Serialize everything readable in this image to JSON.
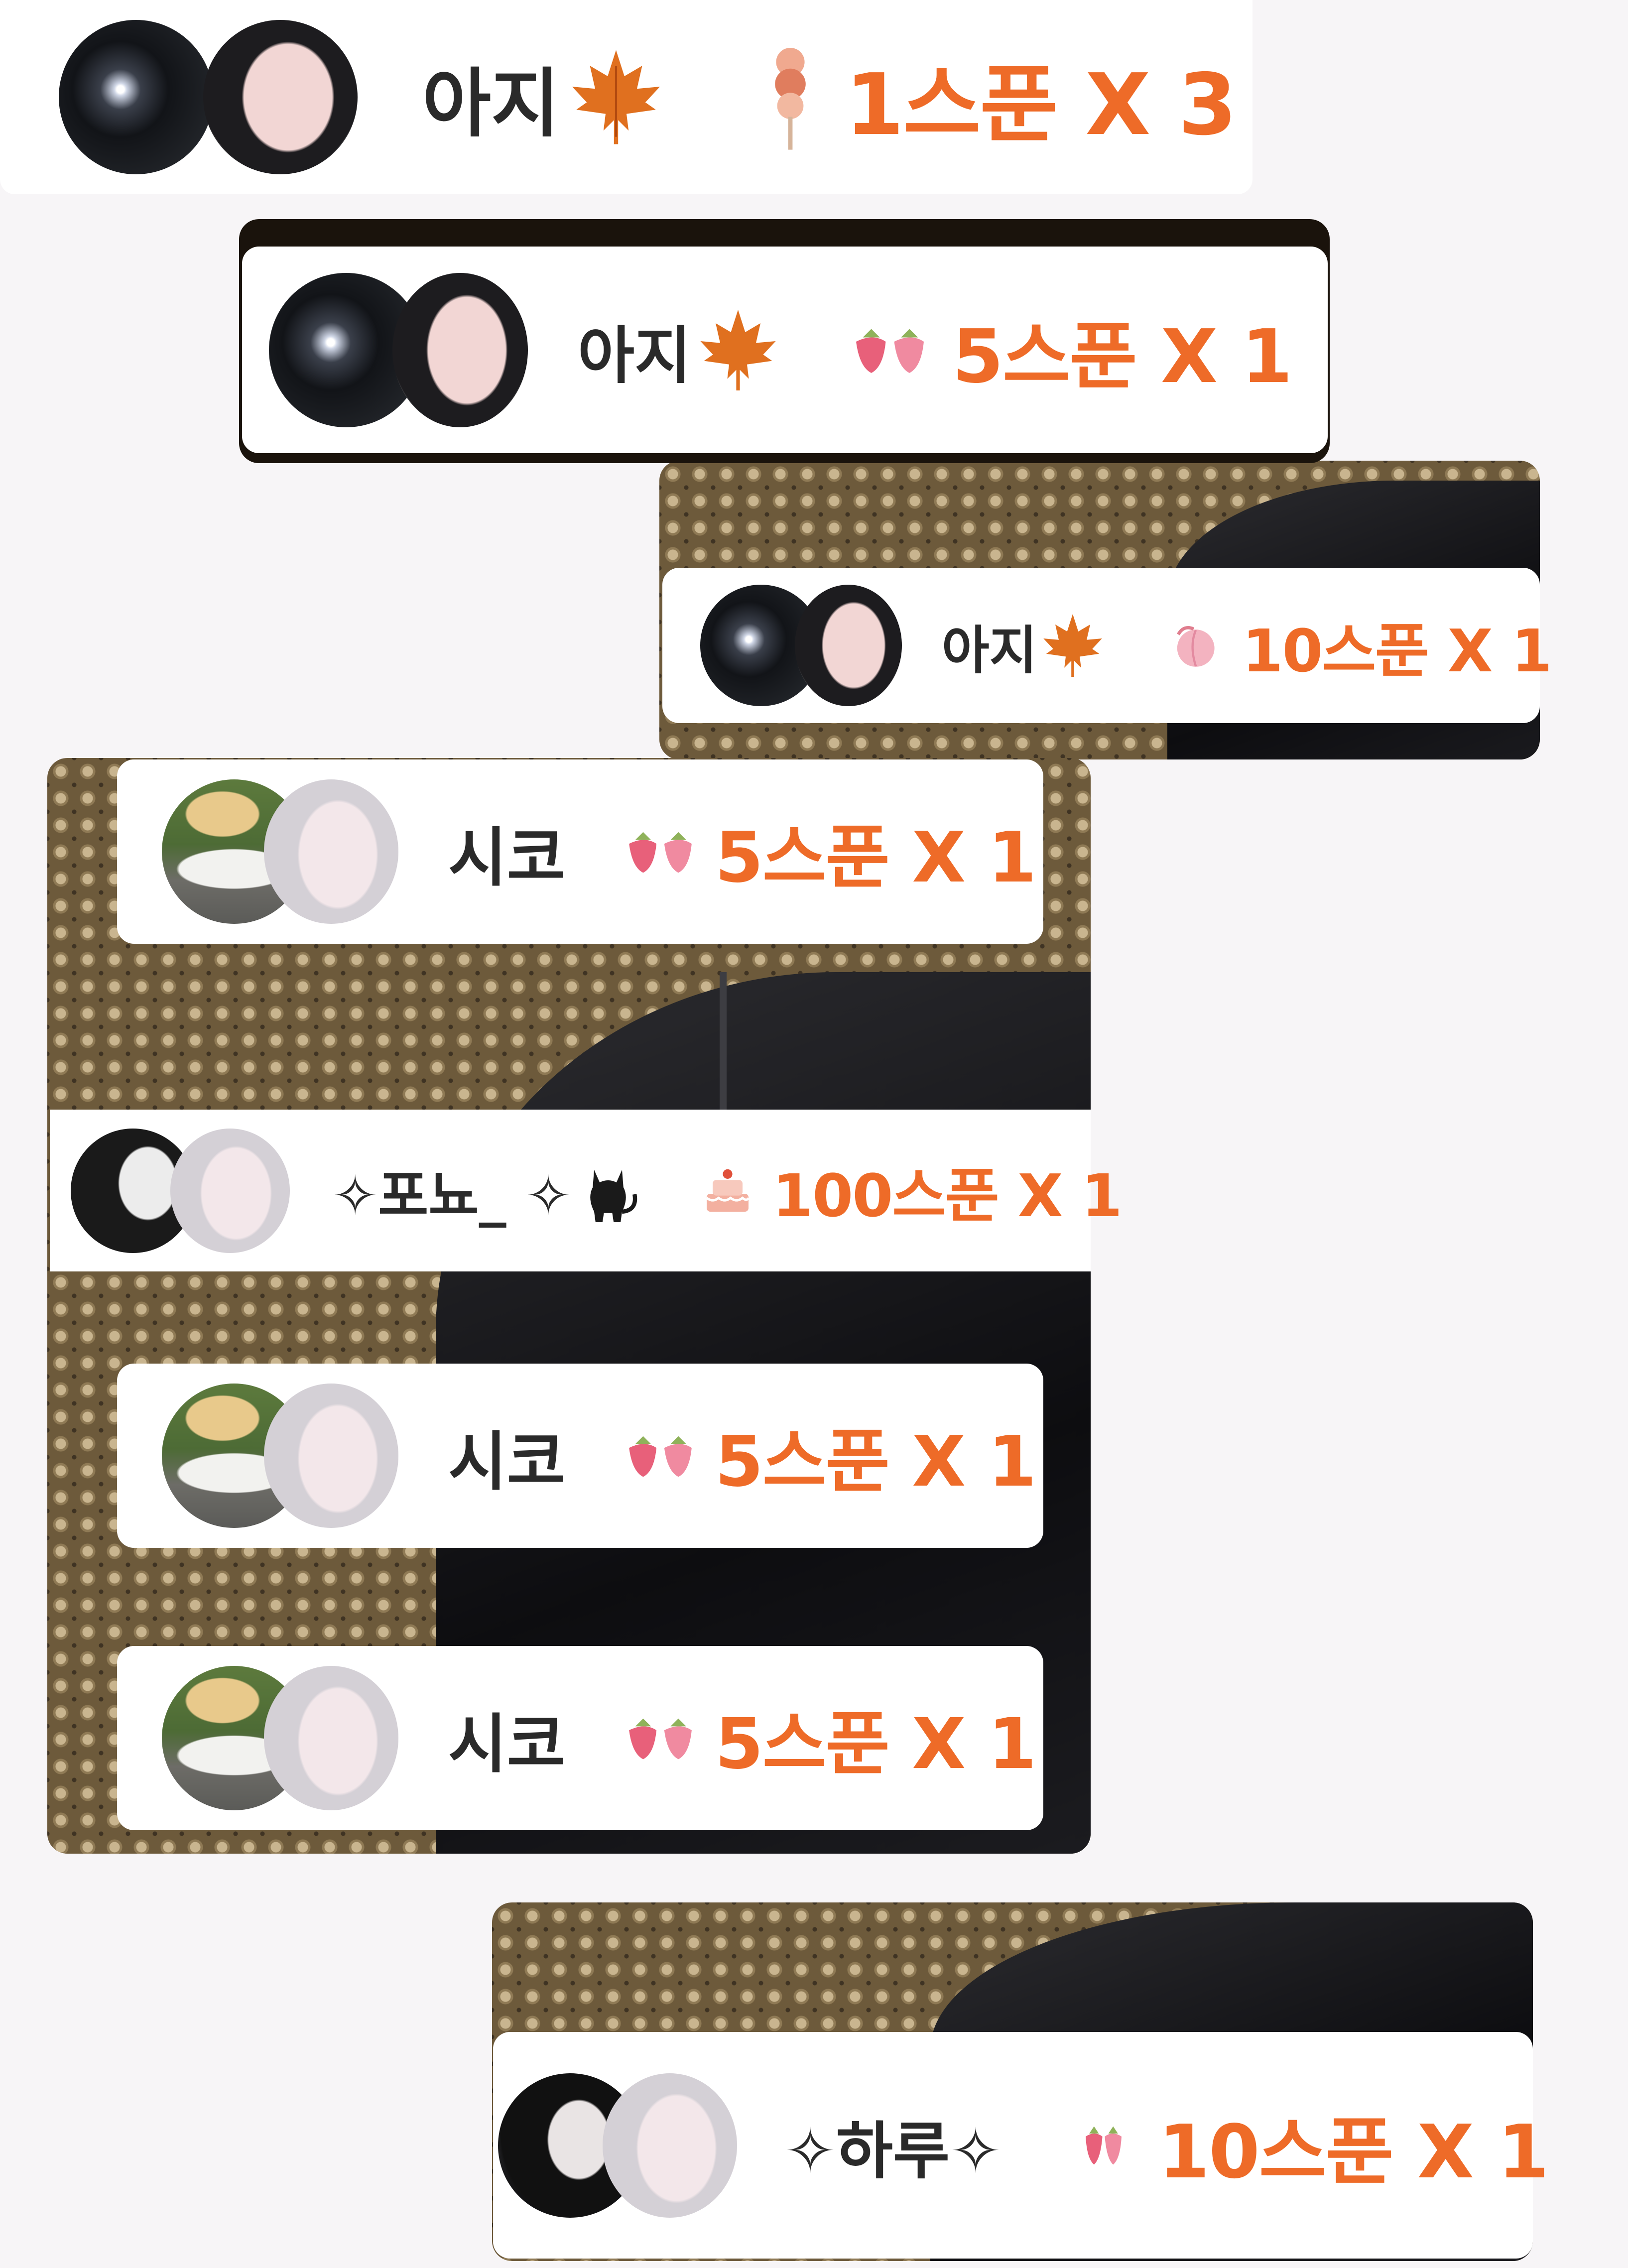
{
  "cards": [
    {
      "name": "아지",
      "badge": "maple-leaf",
      "gift_icon": "ice-cream-icon",
      "amount": "1스푼 X 3"
    },
    {
      "name": "아지",
      "badge": "maple-leaf",
      "gift_icon": "strawberry-icon",
      "amount": "5스푼 X 1"
    },
    {
      "name": "아지",
      "badge": "maple-leaf",
      "gift_icon": "peach-icon",
      "amount": "10스푼 X 1"
    },
    {
      "name": "시코",
      "badge": "",
      "gift_icon": "strawberry-icon",
      "amount": "5스푼 X 1"
    },
    {
      "name": "✧포뇨_ ✧",
      "badge": "black-cat",
      "gift_icon": "cake-icon",
      "amount": "100스푼 X 1"
    },
    {
      "name": "시코",
      "badge": "",
      "gift_icon": "strawberry-icon",
      "amount": "5스푼 X 1"
    },
    {
      "name": "시코",
      "badge": "",
      "gift_icon": "strawberry-icon",
      "amount": "5스푼 X 1"
    },
    {
      "name": "✧하루✧",
      "badge": "",
      "gift_icon": "strawberry-icon",
      "amount": "10스푼 X 1"
    }
  ],
  "colors": {
    "amount": "#ee6b28",
    "name": "#2a2a2a",
    "card": "#ffffff",
    "page": "#f7f5f7"
  }
}
